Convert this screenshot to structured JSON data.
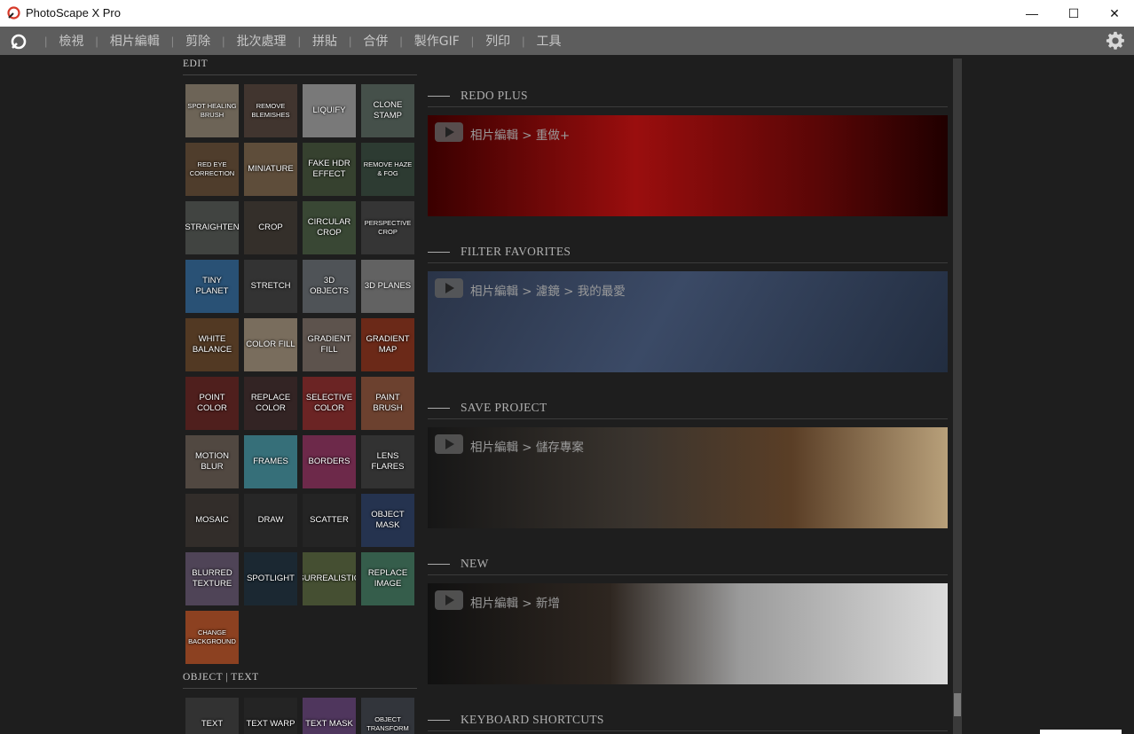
{
  "titlebar": {
    "app_title": "PhotoScape X Pro",
    "minimize": "—",
    "maximize": "☐",
    "close": "✕"
  },
  "menu": {
    "items": [
      "檢視",
      "相片編輯",
      "剪除",
      "批次處理",
      "拼貼",
      "合併",
      "製作GIF",
      "列印",
      "工具"
    ]
  },
  "left_panel": {
    "edit_heading": "EDIT",
    "tools": [
      {
        "label": "SPOT HEALING BRUSH",
        "bg": "#7d7263"
      },
      {
        "label": "REMOVE BLEMISHES",
        "bg": "#4a3d36"
      },
      {
        "label": "LIQUIFY",
        "bg": "#8a8a8a"
      },
      {
        "label": "CLONE STAMP",
        "bg": "#4f5c55"
      },
      {
        "label": "RED EYE CORRECTION",
        "bg": "#5a4633"
      },
      {
        "label": "MINIATURE",
        "bg": "#6b5842"
      },
      {
        "label": "FAKE HDR EFFECT",
        "bg": "#3e4a36"
      },
      {
        "label": "REMOVE HAZE & FOG",
        "bg": "#34443a"
      },
      {
        "label": "STRAIGHTEN",
        "bg": "#4a4e4a"
      },
      {
        "label": "CROP",
        "bg": "#3c3630"
      },
      {
        "label": "CIRCULAR CROP",
        "bg": "#41513c"
      },
      {
        "label": "PERSPECTIVE CROP",
        "bg": "#3d3d3d"
      },
      {
        "label": "TINY PLANET",
        "bg": "#2f5d86"
      },
      {
        "label": "STRETCH",
        "bg": "#3b3b3b"
      },
      {
        "label": "3D OBJECTS",
        "bg": "#5b5f63"
      },
      {
        "label": "3D PLANES",
        "bg": "#707070"
      },
      {
        "label": "WHITE BALANCE",
        "bg": "#5e4128"
      },
      {
        "label": "COLOR FILL",
        "bg": "#8a7d6a"
      },
      {
        "label": "GRADIENT FILL",
        "bg": "#6a5f58"
      },
      {
        "label": "GRADIENT MAP",
        "bg": "#7a2f1c"
      },
      {
        "label": "POINT COLOR",
        "bg": "#5a2422"
      },
      {
        "label": "REPLACE COLOR",
        "bg": "#3b2a2a"
      },
      {
        "label": "SELECTIVE COLOR",
        "bg": "#7a2a2a"
      },
      {
        "label": "PAINT BRUSH",
        "bg": "#7b4a36"
      },
      {
        "label": "MOTION BLUR",
        "bg": "#5d524b"
      },
      {
        "label": "FRAMES",
        "bg": "#3e7f8a"
      },
      {
        "label": "BORDERS",
        "bg": "#7d2f55"
      },
      {
        "label": "LENS FLARES",
        "bg": "#3a3a3a"
      },
      {
        "label": "MOSAIC",
        "bg": "#3a3430"
      },
      {
        "label": "DRAW",
        "bg": "#2d2d2d"
      },
      {
        "label": "SCATTER",
        "bg": "#2a2a2a"
      },
      {
        "label": "OBJECT MASK",
        "bg": "#2b3b5a"
      },
      {
        "label": "BLURRED TEXTURE",
        "bg": "#5a4e63"
      },
      {
        "label": "SPOTLIGHT",
        "bg": "#1f2e3a"
      },
      {
        "label": "SURREALISTIC",
        "bg": "#4f5a3a"
      },
      {
        "label": "REPLACE IMAGE",
        "bg": "#3d6a56"
      },
      {
        "label": "CHANGE BACKGROUND",
        "bg": "#a04a26"
      }
    ],
    "object_heading": "OBJECT | TEXT",
    "object_tools": [
      {
        "label": "TEXT",
        "bg": "#3a3a3a"
      },
      {
        "label": "TEXT WARP",
        "bg": "#2a2a2a"
      },
      {
        "label": "TEXT MASK",
        "bg": "#5a3e6a"
      },
      {
        "label": "OBJECT TRANSFORM",
        "bg": "#3a3d44"
      }
    ]
  },
  "right_panel": {
    "cards": [
      {
        "title": "REDO PLUS",
        "video": "相片編輯 > 重做+",
        "bg": "linear-gradient(90deg,#3a0000,#9a0e0e 40%,#5a0606 75%,#200000)"
      },
      {
        "title": "FILTER FAVORITES",
        "video": "相片編輯 > 濾鏡 > 我的最愛",
        "bg": "linear-gradient(120deg,#2a3448,#3b4a66 45%,#222d40)"
      },
      {
        "title": "SAVE PROJECT",
        "video": "相片編輯 > 儲存專案",
        "bg": "linear-gradient(90deg,#161616,#3a342e 40%,#5a3e26 70%,#b8a07a)"
      },
      {
        "title": "NEW",
        "video": "相片編輯 > 新增",
        "bg": "linear-gradient(90deg,#111,#2e2620 35%,#9a9a9a 60%,#dcdcdc)"
      },
      {
        "title": "KEYBOARD SHORTCUTS",
        "video": "",
        "bg": "#1e1e1e"
      }
    ]
  }
}
